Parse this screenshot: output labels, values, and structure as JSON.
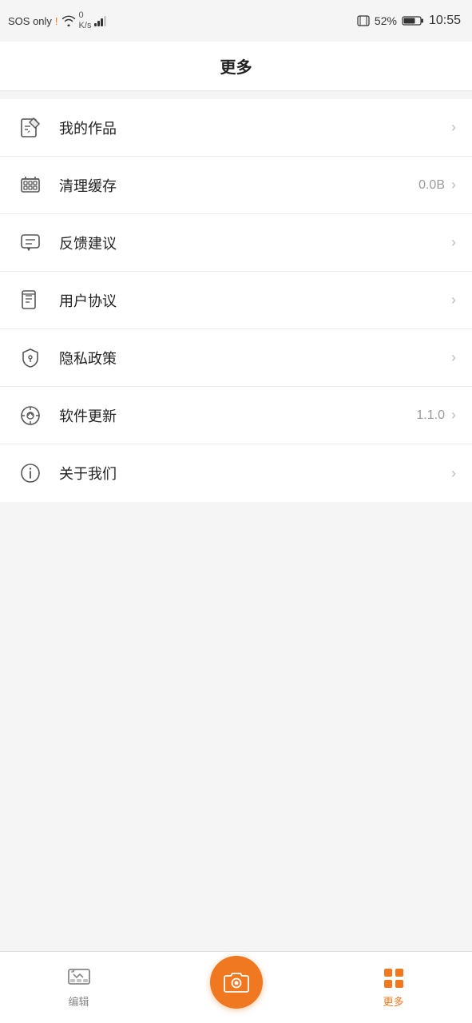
{
  "statusBar": {
    "sosText": "SOS only",
    "network": "0\nK/s",
    "batteryPercent": "52%",
    "time": "10:55"
  },
  "pageTitle": "更多",
  "menuItems": [
    {
      "id": "my-works",
      "label": "我的作品",
      "value": "",
      "icon": "edit-icon"
    },
    {
      "id": "clear-cache",
      "label": "清理缓存",
      "value": "0.0B",
      "icon": "cache-icon"
    },
    {
      "id": "feedback",
      "label": "反馈建议",
      "value": "",
      "icon": "feedback-icon"
    },
    {
      "id": "user-agreement",
      "label": "用户协议",
      "value": "",
      "icon": "agreement-icon"
    },
    {
      "id": "privacy-policy",
      "label": "隐私政策",
      "value": "",
      "icon": "privacy-icon"
    },
    {
      "id": "software-update",
      "label": "软件更新",
      "value": "1.1.0",
      "icon": "update-icon"
    },
    {
      "id": "about-us",
      "label": "关于我们",
      "value": "",
      "icon": "about-icon"
    }
  ],
  "bottomNav": {
    "editLabel": "编辑",
    "cameraLabel": "",
    "moreLabel": "更多"
  }
}
